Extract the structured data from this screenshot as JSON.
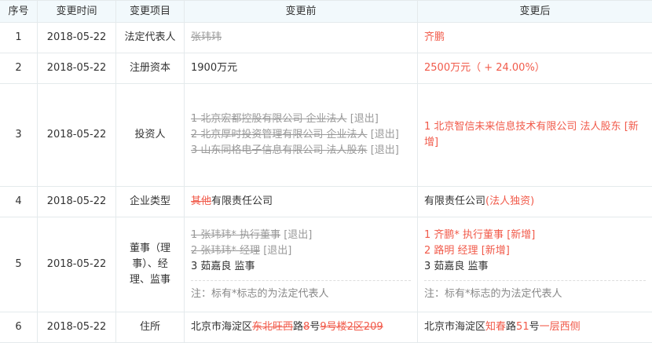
{
  "headers": {
    "index": "序号",
    "date": "变更时间",
    "item": "变更项目",
    "before": "变更前",
    "after": "变更后"
  },
  "rows": [
    {
      "index": "1",
      "date": "2018-05-22",
      "item": "法定代表人",
      "before_del": "张玮玮",
      "after": "齐鹏"
    },
    {
      "index": "2",
      "date": "2018-05-22",
      "item": "注册资本",
      "before": "1900万元",
      "after": "2500万元（ + 24.00%）"
    },
    {
      "index": "3",
      "date": "2018-05-22",
      "item": "投资人",
      "before": [
        {
          "del": "1 北京宏都控股有限公司 企业法人",
          "tag": "[退出]"
        },
        {
          "del": "2 北京厚时投资管理有限公司 企业法人",
          "tag": "[退出]"
        },
        {
          "del": "3 山东同格电子信息有限公司 法人股东",
          "tag": "[退出]"
        }
      ],
      "after": [
        {
          "text": "1 北京智信未来信息技术有限公司 法人股东",
          "tag": "[新增]"
        }
      ]
    },
    {
      "index": "4",
      "date": "2018-05-22",
      "item": "企业类型",
      "before_del": "其他",
      "before_rest": "有限责任公司",
      "after_main": "有限责任公司",
      "after_red": "(法人独资)"
    },
    {
      "index": "5",
      "date": "2018-05-22",
      "item_parts": [
        "董事（理",
        "事）、经",
        "理、监事"
      ],
      "before": [
        {
          "del": "1 张玮玮* 执行董事",
          "tag": "[退出]"
        },
        {
          "del": "2 张玮玮* 经理",
          "tag": "[退出]"
        }
      ],
      "before_plain": "3 茹嘉良 监事",
      "after": [
        {
          "text": "1 齐鹏* 执行董事",
          "tag": "[新增]"
        },
        {
          "text": "2 路明 经理",
          "tag": "[新增]"
        }
      ],
      "after_plain": "3 茹嘉良 监事",
      "note": "注：标有*标志的为法定代表人"
    },
    {
      "index": "6",
      "date": "2018-05-22",
      "item": "住所",
      "before_prefix": "北京市海淀区",
      "before_del1": "东北旺西",
      "before_mid1": "路",
      "before_del2": "8",
      "before_mid2": "号",
      "before_del3": "9号楼2区209",
      "after_prefix": "北京市海淀区",
      "after_red1": "知春",
      "after_mid1": "路",
      "after_red2": "51",
      "after_mid2": "号",
      "after_red3": "一层西侧"
    }
  ]
}
